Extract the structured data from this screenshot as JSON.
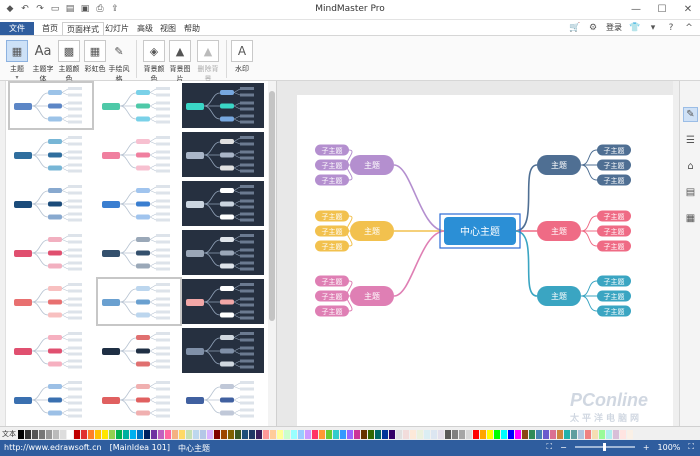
{
  "app": {
    "title": "MindMaster Pro"
  },
  "menu": {
    "file": "文件",
    "tabs": [
      "首页",
      "页面样式",
      "幻灯片",
      "高级",
      "视图",
      "帮助"
    ],
    "active_tab": "页面样式",
    "login": "登录"
  },
  "ribbon": {
    "buttons": [
      {
        "label": "主题",
        "icon": "theme-icon",
        "active": true
      },
      {
        "label": "主题字体",
        "icon": "font-icon"
      },
      {
        "label": "主题颜色",
        "icon": "palette-icon"
      },
      {
        "label": "彩虹色",
        "icon": "rainbow-icon"
      },
      {
        "label": "手绘风格",
        "icon": "pen-icon"
      },
      {
        "label": "背景颜色",
        "icon": "bucket-icon"
      },
      {
        "label": "背景图片",
        "icon": "image-icon"
      },
      {
        "label": "删除背景",
        "icon": "delete-bg-icon",
        "disabled": true
      },
      {
        "label": "水印",
        "icon": "watermark-icon"
      }
    ]
  },
  "mindmap": {
    "center": "中心主题",
    "branches": [
      {
        "label": "主题",
        "color": "#b48fcf",
        "subs": [
          "子主题",
          "子主题",
          "子主题"
        ]
      },
      {
        "label": "主题",
        "color": "#f2c14e",
        "subs": [
          "子主题",
          "子主题",
          "子主题"
        ]
      },
      {
        "label": "主题",
        "color": "#df7fb4",
        "subs": [
          "子主题",
          "子主题",
          "子主题"
        ]
      },
      {
        "label": "主题",
        "color": "#4f6f93",
        "subs": [
          "子主题",
          "子主题",
          "子主题"
        ]
      },
      {
        "label": "主题",
        "color": "#ef6b85",
        "subs": [
          "子主题",
          "子主题",
          "子主题"
        ]
      },
      {
        "label": "主题",
        "color": "#3aa5c2",
        "subs": [
          "子主题",
          "子主题",
          "子主题"
        ]
      }
    ],
    "center_color": "#2b8fd6"
  },
  "colorbar": {
    "label": "文本"
  },
  "status": {
    "url": "http://www.edrawsoft.cn",
    "doc": "[MainIdea 101]",
    "selection": "中心主题",
    "zoom": "100%"
  },
  "watermark": {
    "brand": "PConline",
    "sub": "太平洋电脑网"
  }
}
